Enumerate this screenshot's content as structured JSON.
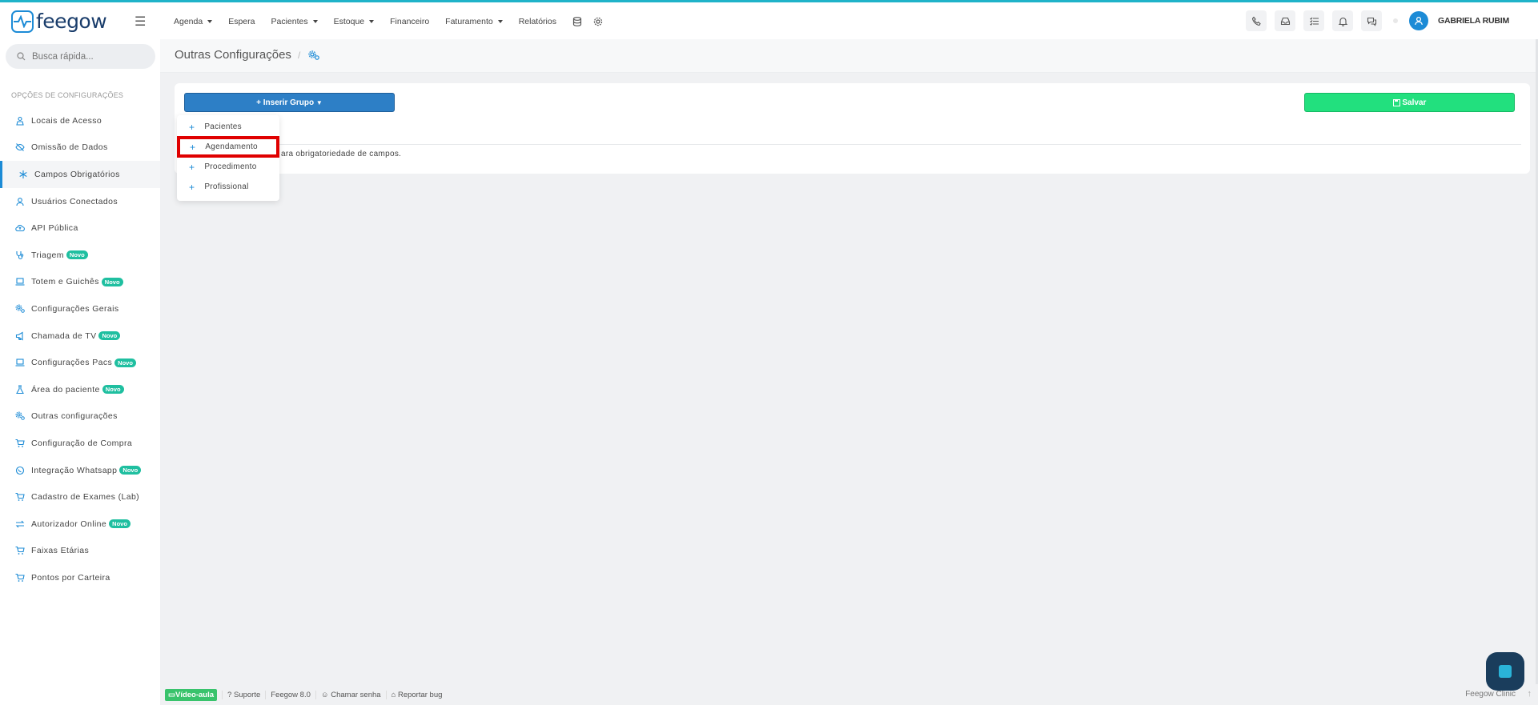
{
  "app": {
    "logo_text": "feegow",
    "brand_color": "#1c8bd6",
    "accent_color": "#1fb3c9"
  },
  "topnav": {
    "items": [
      {
        "label": "Agenda",
        "has_caret": true
      },
      {
        "label": "Espera",
        "has_caret": false
      },
      {
        "label": "Pacientes",
        "has_caret": true
      },
      {
        "label": "Estoque",
        "has_caret": true
      },
      {
        "label": "Financeiro",
        "has_caret": false
      },
      {
        "label": "Faturamento",
        "has_caret": true
      },
      {
        "label": "Relatórios",
        "has_caret": false
      }
    ],
    "icons": [
      "database-icon",
      "gear-icon"
    ]
  },
  "header_right": {
    "icons": [
      "phone-icon",
      "inbox-icon",
      "checklist-icon",
      "bell-icon",
      "chat-icon"
    ],
    "username": "GABRIELA RUBIM"
  },
  "search": {
    "placeholder": "Busca rápida..."
  },
  "sidebar": {
    "section_title": "OPÇÕES DE CONFIGURAÇÕES",
    "items": [
      {
        "label": "Locais de Acesso",
        "icon": "user-pin-icon",
        "badge": ""
      },
      {
        "label": "Omissão de Dados",
        "icon": "eye-off-icon",
        "badge": ""
      },
      {
        "label": "Campos Obrigatórios",
        "icon": "asterisk-icon",
        "badge": "",
        "active": true
      },
      {
        "label": "Usuários Conectados",
        "icon": "user-icon",
        "badge": ""
      },
      {
        "label": "API Pública",
        "icon": "cloud-icon",
        "badge": ""
      },
      {
        "label": "Triagem",
        "icon": "stethoscope-icon",
        "badge": "Novo"
      },
      {
        "label": "Totem e Guichês",
        "icon": "laptop-icon",
        "badge": "Novo"
      },
      {
        "label": "Configurações Gerais",
        "icon": "gears-icon",
        "badge": ""
      },
      {
        "label": "Chamada de TV",
        "icon": "megaphone-icon",
        "badge": "Novo"
      },
      {
        "label": "Configurações Pacs",
        "icon": "laptop-icon",
        "badge": "Novo"
      },
      {
        "label": "Área do paciente",
        "icon": "flask-icon",
        "badge": "Novo"
      },
      {
        "label": "Outras configurações",
        "icon": "gears-icon",
        "badge": ""
      },
      {
        "label": "Configuração de Compra",
        "icon": "cart-icon",
        "badge": ""
      },
      {
        "label": "Integração Whatsapp",
        "icon": "whatsapp-icon",
        "badge": "Novo"
      },
      {
        "label": "Cadastro de Exames (Lab)",
        "icon": "cart-icon",
        "badge": ""
      },
      {
        "label": "Autorizador Online",
        "icon": "arrows-icon",
        "badge": "Novo"
      },
      {
        "label": "Faixas Etárias",
        "icon": "cart-icon",
        "badge": ""
      },
      {
        "label": "Pontos por Carteira",
        "icon": "cart-icon",
        "badge": ""
      }
    ]
  },
  "main": {
    "page_title": "Outras Configurações",
    "insert_group_label": "Inserir Grupo",
    "save_label": "Salvar",
    "hint_text": "ara obrigatoriedade de campos.",
    "dropdown": [
      "Pacientes",
      "Agendamento",
      "Procedimento",
      "Profissional"
    ],
    "dropdown_highlighted": "Agendamento"
  },
  "footer": {
    "video": "Vídeo-aula",
    "support": "Suporte",
    "version": "Feegow 8.0",
    "call": "Chamar senha",
    "bug": "Reportar bug",
    "brand": "Feegow Clinic"
  }
}
